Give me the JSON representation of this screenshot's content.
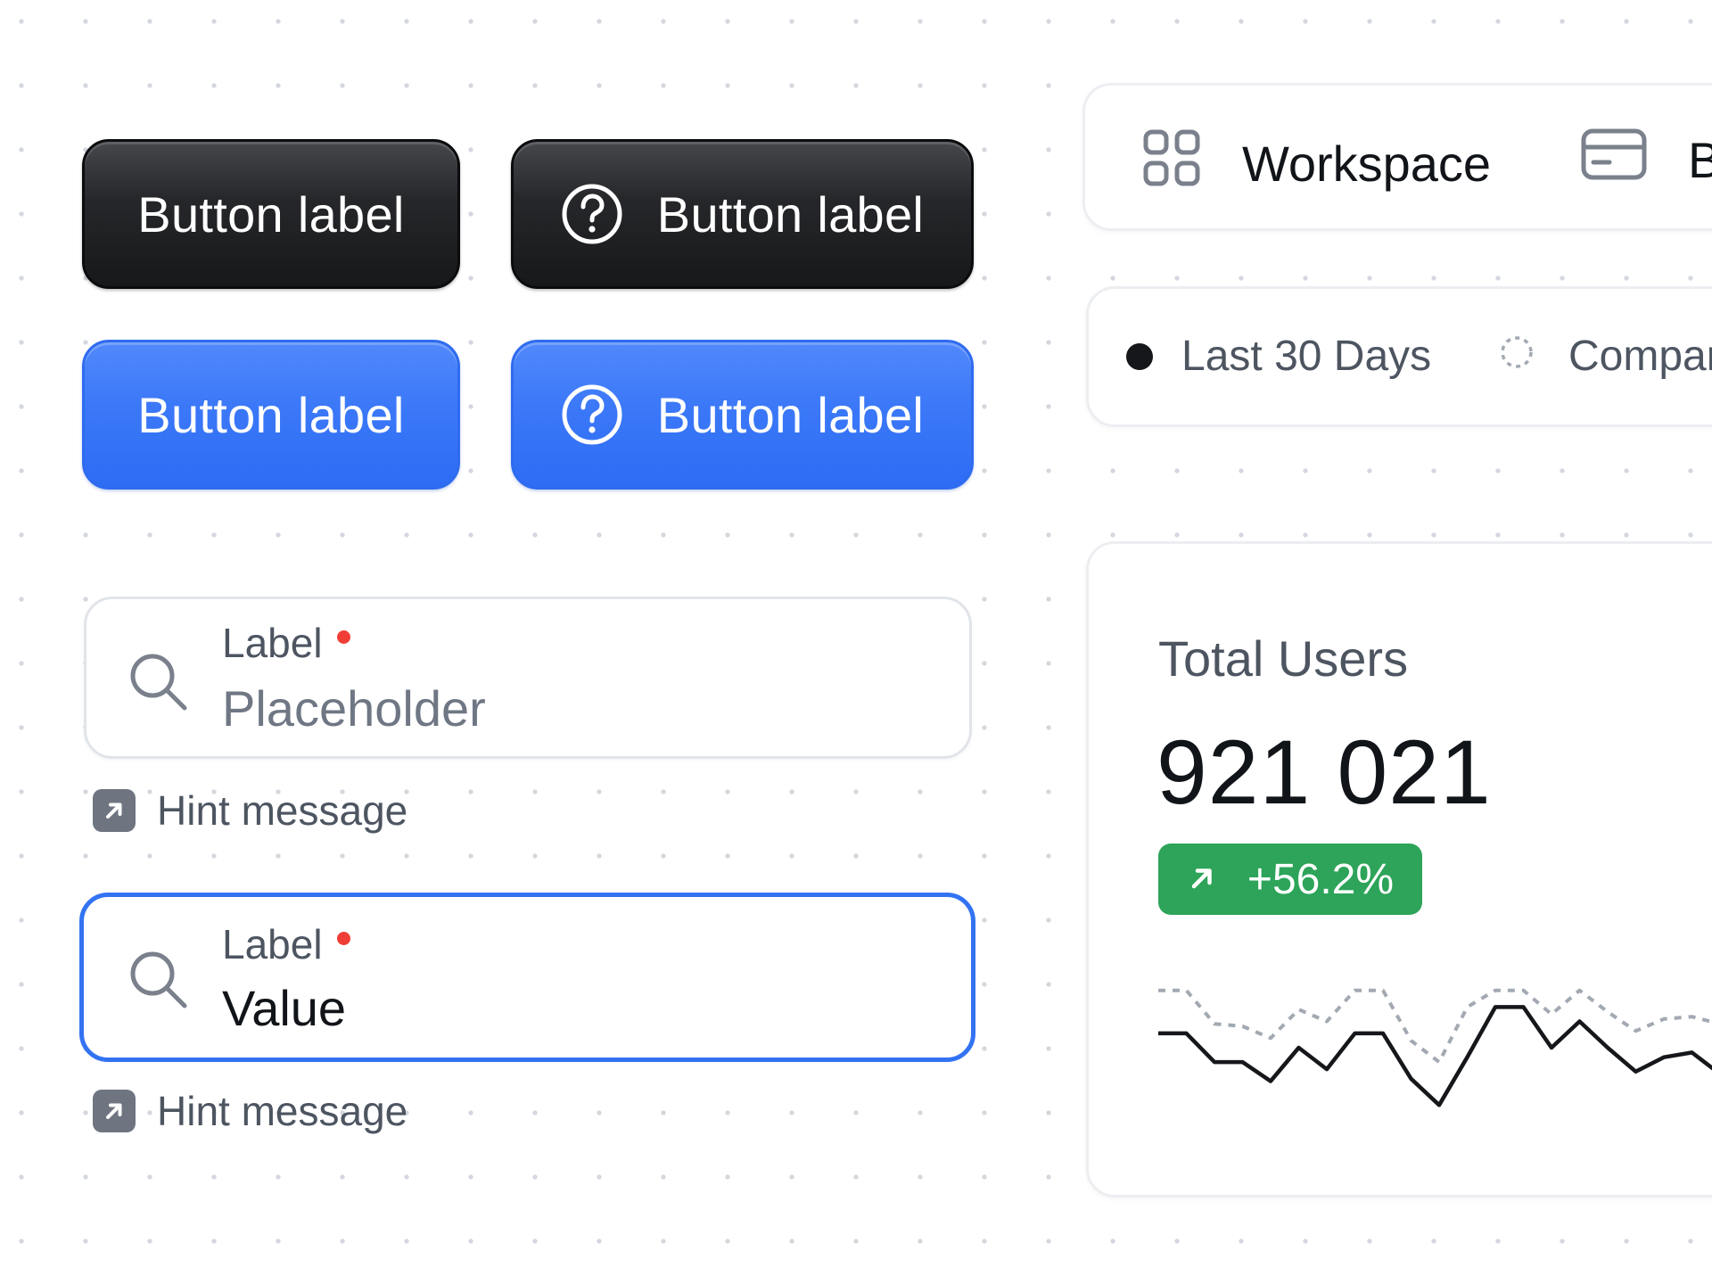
{
  "buttons": [
    {
      "label": "Button label",
      "style": "dark",
      "icon": "help-circle-icon"
    },
    {
      "label": "Button label",
      "style": "dark",
      "icon": "help-circle-icon"
    },
    {
      "label": "Button label",
      "style": "blue",
      "icon": "help-circle-icon"
    },
    {
      "label": "Button label",
      "style": "blue",
      "icon": "help-circle-icon"
    }
  ],
  "fields": {
    "search_idle": {
      "label": "Label",
      "placeholder": "Placeholder",
      "value": "",
      "required": true,
      "icon": "search-icon"
    },
    "search_focused": {
      "label": "Label",
      "placeholder": "",
      "value": "Value",
      "required": true,
      "icon": "search-icon"
    }
  },
  "hints": [
    {
      "text": "Hint message",
      "icon": "arrow-up-right-icon"
    },
    {
      "text": "Hint message",
      "icon": "arrow-up-right-icon"
    }
  ],
  "nav": {
    "items": [
      {
        "label": "Workspace",
        "icon": "grid-icon"
      },
      {
        "label": "B",
        "icon": "credit-card-icon"
      }
    ]
  },
  "filters": {
    "current": {
      "label": "Last 30 Days",
      "icon": "solid-dot-icon"
    },
    "compare": {
      "label": "Compar",
      "icon": "dashed-circle-icon"
    }
  },
  "stat": {
    "title": "Total Users",
    "value": "921 021",
    "change": "+56.2%",
    "change_icon": "arrow-up-right-icon"
  },
  "colors": {
    "primary_blue": "#3373f2",
    "dark_button": "#1f2023",
    "success_green": "#2da459",
    "required_red": "#f03e36",
    "muted_text": "#4d5561"
  },
  "sparkline": {
    "current": [
      0.62,
      0.62,
      0.38,
      0.38,
      0.22,
      0.5,
      0.32,
      0.62,
      0.62,
      0.24,
      0.02,
      0.42,
      0.84,
      0.84,
      0.5,
      0.72,
      0.5,
      0.3,
      0.42,
      0.46,
      0.28
    ],
    "previous": [
      0.98,
      0.98,
      0.7,
      0.68,
      0.58,
      0.82,
      0.72,
      0.98,
      0.98,
      0.56,
      0.38,
      0.84,
      0.98,
      0.98,
      0.78,
      0.98,
      0.8,
      0.64,
      0.74,
      0.76,
      0.7
    ]
  }
}
